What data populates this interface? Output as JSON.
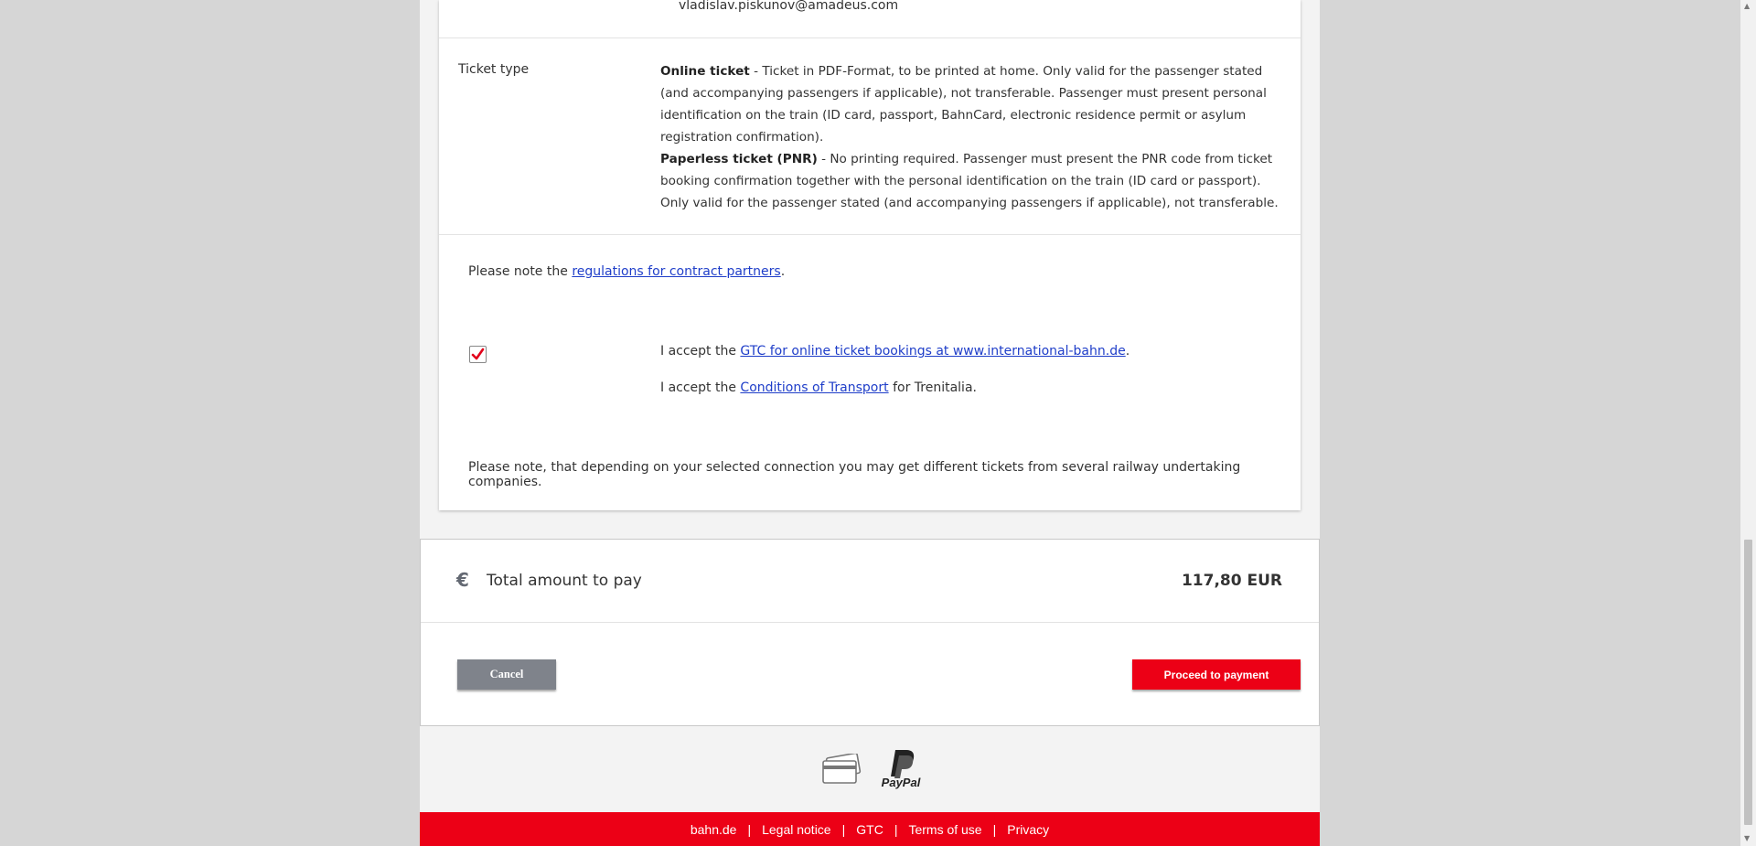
{
  "contact": {
    "email": "vladislav.piskunov@amadeus.com"
  },
  "ticket_type": {
    "label": "Ticket type",
    "online_title": "Online ticket",
    "online_text": " - Ticket in PDF-Format, to be printed at home. Only valid for the passenger stated (and accompanying passengers if applicable), not transferable. Passenger must present personal identification on the train (ID card, passport, BahnCard, electronic residence permit or asylum registration confirmation).",
    "paperless_title": "Paperless ticket (PNR)",
    "paperless_text": " - No printing required. Passenger must present the PNR code from ticket booking confirmation together with the personal identification on the train (ID card or passport). Only valid for the passenger stated (and accompanying passengers if applicable), not transferable."
  },
  "regulations": {
    "prefix": "Please note the ",
    "link": "regulations for contract partners",
    "suffix": "."
  },
  "terms": {
    "checked": true,
    "gtc_prefix": "I accept the ",
    "gtc_link": "GTC for online ticket bookings at www.international-bahn.de",
    "gtc_suffix": ".",
    "transport_prefix": "I accept the ",
    "transport_link": "Conditions of Transport",
    "transport_suffix": " for Trenitalia."
  },
  "note": "Please note, that depending on your selected connection you may get different tickets from several railway undertaking companies.",
  "total": {
    "currency_icon": "euro-icon",
    "label": "Total amount to pay",
    "amount": "117,80 EUR"
  },
  "actions": {
    "cancel_label": "Cancel",
    "proceed_label": "Proceed to payment"
  },
  "payment_methods": {
    "paypal_text": "PayPal"
  },
  "footer": {
    "links": [
      "bahn.de",
      "Legal notice",
      "GTC",
      "Terms of use",
      "Privacy"
    ]
  },
  "colors": {
    "brand_red": "#ec0016",
    "link_blue": "#1f3ec9",
    "cancel_grey": "#7f838b"
  }
}
